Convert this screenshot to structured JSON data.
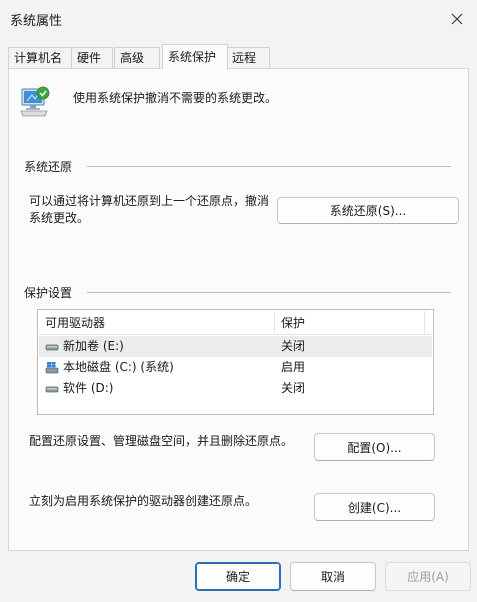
{
  "window": {
    "title": "系统属性"
  },
  "tabs": [
    {
      "label": "计算机名"
    },
    {
      "label": "硬件"
    },
    {
      "label": "高级"
    },
    {
      "label": "系统保护",
      "active": true
    },
    {
      "label": "远程"
    }
  ],
  "intro": {
    "text": "使用系统保护撤消不需要的系统更改。",
    "icon": "system-protection-icon"
  },
  "system_restore": {
    "section_title": "系统还原",
    "description": "可以通过将计算机还原到上一个还原点，撤消系统更改。",
    "button_label": "系统还原(S)..."
  },
  "protection_settings": {
    "section_title": "保护设置",
    "columns": [
      "可用驱动器",
      "保护"
    ],
    "drives": [
      {
        "name": "新加卷 (E:)",
        "protection": "关闭",
        "icon": "drive-icon",
        "selected": true
      },
      {
        "name": "本地磁盘 (C:) (系统)",
        "protection": "启用",
        "icon": "windows-drive-icon",
        "selected": false
      },
      {
        "name": "软件 (D:)",
        "protection": "关闭",
        "icon": "drive-icon",
        "selected": false
      }
    ],
    "configure_text": "配置还原设置、管理磁盘空间，并且删除还原点。",
    "configure_button": "配置(O)...",
    "create_text": "立刻为启用系统保护的驱动器创建还原点。",
    "create_button": "创建(C)..."
  },
  "footer": {
    "ok": "确定",
    "cancel": "取消",
    "apply": "应用(A)"
  },
  "colors": {
    "accent": "#2a6fb5",
    "selected_row": "#ececec",
    "window_bg": "#f3f3f3"
  }
}
